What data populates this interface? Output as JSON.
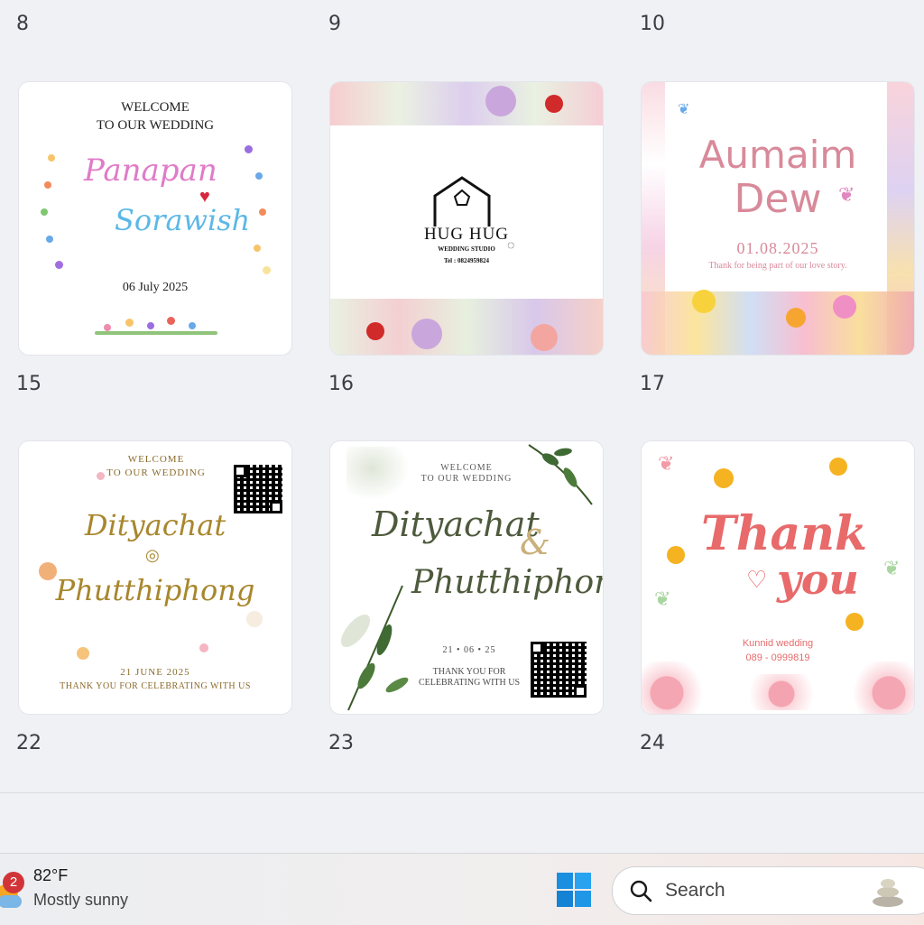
{
  "grid": {
    "row_numbers_top": [
      "8",
      "9",
      "10"
    ],
    "row_numbers_mid": [
      "15",
      "16",
      "17"
    ],
    "row_numbers_bottom": [
      "22",
      "23",
      "24"
    ]
  },
  "cards": {
    "c15": {
      "welcome_line1": "WELCOME",
      "welcome_line2": "TO OUR WEDDING",
      "name1": "Panapan",
      "name2": "Sorawish",
      "date": "06 July 2025"
    },
    "c16": {
      "brand": "HUG HUG",
      "subtitle": "WEDDING STUDIO",
      "tel": "Tel : 0824959824"
    },
    "c17": {
      "name1": "Aumaim",
      "name2": "Dew",
      "date": "01.08.2025",
      "message": "Thank for being part of our love story."
    },
    "c22": {
      "welcome_line1": "WELCOME",
      "welcome_line2": "TO OUR WEDDING",
      "name1": "Dityachat",
      "name2": "Phutthiphong",
      "date": "21 JUNE 2025",
      "message": "THANK YOU FOR CELEBRATING WITH US"
    },
    "c23": {
      "welcome_line1": "WELCOME",
      "welcome_line2": "TO OUR WEDDING",
      "name1": "Dityachat",
      "ampersand": "&",
      "name2": "Phutthiphong",
      "date": "21 • 06 • 25",
      "message_line1": "THANK YOU FOR",
      "message_line2": "CELEBRATING WITH US"
    },
    "c24": {
      "line1": "Thank",
      "line2": "you",
      "event": "Kunnid wedding",
      "phone": "089 - 0999819"
    }
  },
  "taskbar": {
    "weather_badge": "2",
    "temperature": "82°F",
    "condition": "Mostly sunny",
    "search_label": "Search",
    "start_icon": "windows-logo-icon",
    "search_icon": "search-icon"
  },
  "colors": {
    "page_bg": "#eff1f5",
    "pink_title": "#d88a9a",
    "gold_script": "#a8862c",
    "green_script": "#4e5a3c",
    "coral_script": "#e86a6a",
    "windows_blue": "#1a8fe0",
    "badge_red": "#d13438"
  }
}
